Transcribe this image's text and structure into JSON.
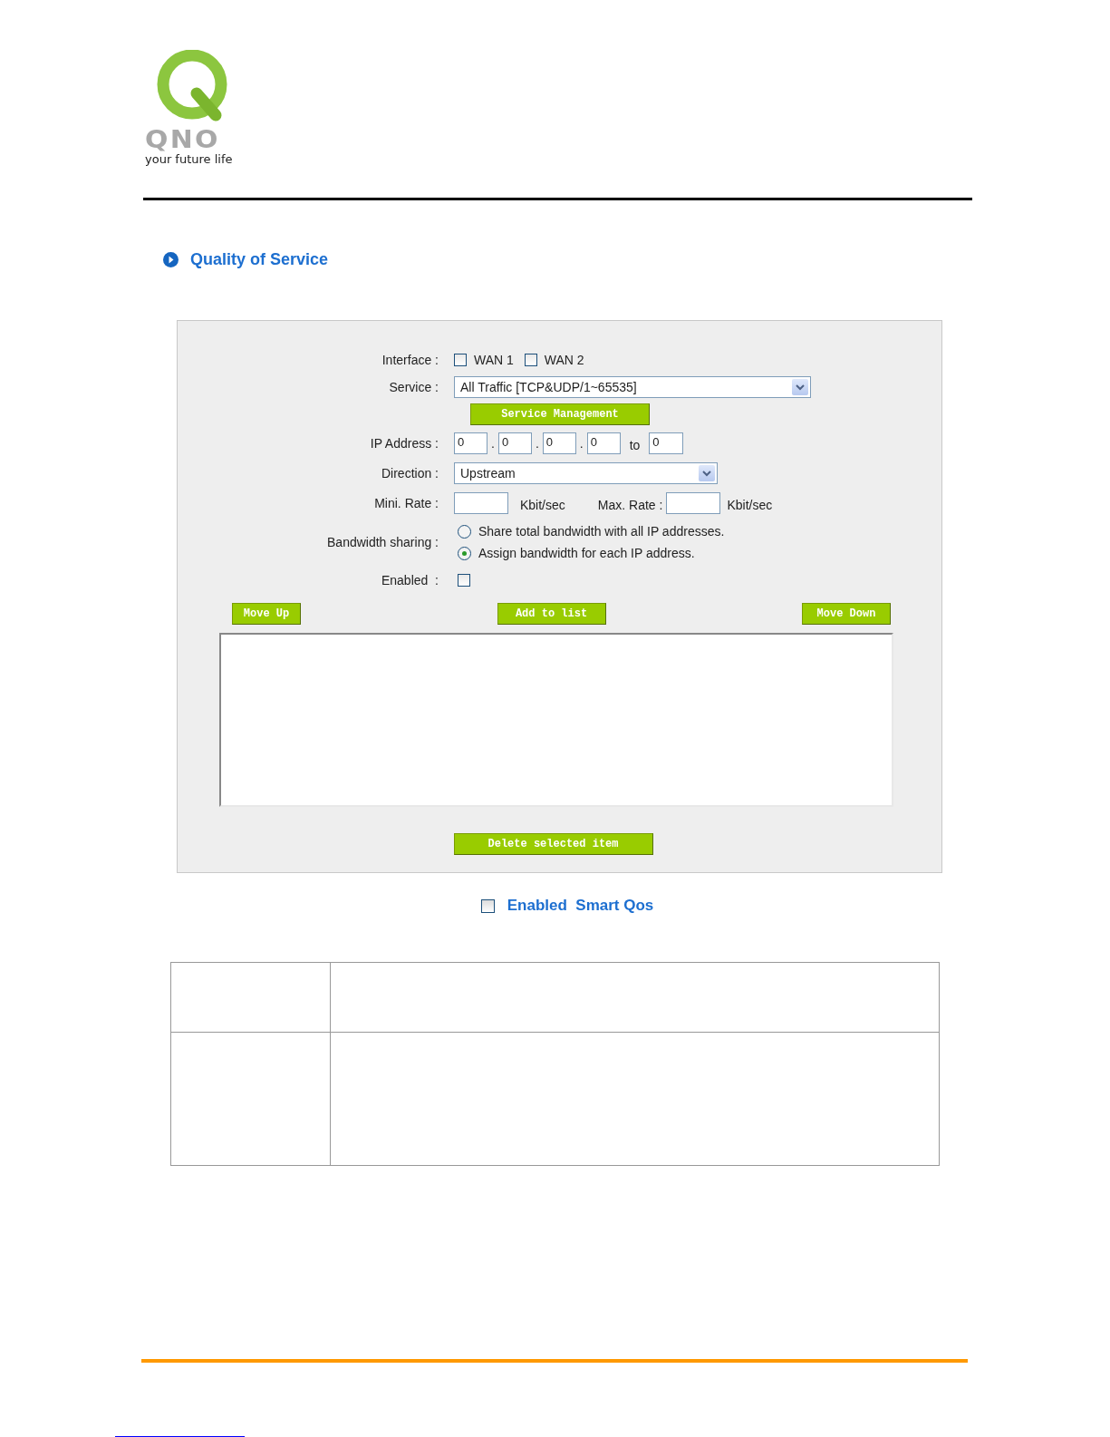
{
  "logo": {
    "wordmark": "QNO",
    "tagline": "your future life"
  },
  "section_title": "Quality of Service",
  "form": {
    "interface": {
      "label": "Interface :",
      "options": [
        {
          "label": "WAN 1",
          "checked": false
        },
        {
          "label": "WAN 2",
          "checked": false
        }
      ]
    },
    "service": {
      "label": "Service :",
      "value": "All Traffic [TCP&UDP/1~65535]"
    },
    "service_button": "Service Management",
    "ip_address": {
      "label": "IP Address :",
      "octets": [
        "0",
        "0",
        "0",
        "0"
      ],
      "separators": [
        ".",
        ".",
        "."
      ],
      "to_label": "to",
      "end": "0"
    },
    "direction": {
      "label": "Direction :",
      "value": "Upstream"
    },
    "min_rate": {
      "label": "Mini. Rate :",
      "unit": "Kbit/sec"
    },
    "max_rate": {
      "label": "Max. Rate :",
      "unit": "Kbit/sec"
    },
    "bandwidth_sharing": {
      "label": "Bandwidth sharing :",
      "options": [
        {
          "label": "Share total bandwidth with all IP addresses.",
          "selected": false
        },
        {
          "label": "Assign bandwidth for each IP address.",
          "selected": true
        }
      ]
    },
    "enabled": {
      "label": "Enabled  :",
      "checked": false
    },
    "list_buttons": [
      "Move Up",
      "Add to list",
      "Move Down"
    ],
    "delete_button": "Delete selected item"
  },
  "smart_qos": {
    "label": "Enabled  Smart Qos",
    "checked": false
  }
}
